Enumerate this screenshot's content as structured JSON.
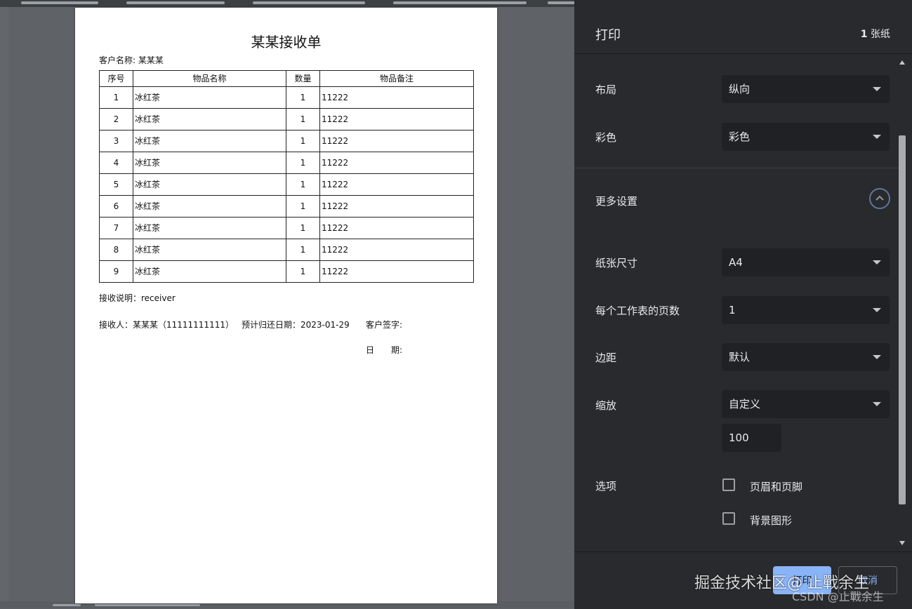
{
  "document": {
    "title": "某某接收单",
    "customer": "客户名称: 某某某",
    "table": {
      "headers": [
        "序号",
        "物品名称",
        "数量",
        "物品备注"
      ],
      "rows": [
        [
          "1",
          "冰红茶",
          "1",
          "11222"
        ],
        [
          "2",
          "冰红茶",
          "1",
          "11222"
        ],
        [
          "3",
          "冰红茶",
          "1",
          "11222"
        ],
        [
          "4",
          "冰红茶",
          "1",
          "11222"
        ],
        [
          "5",
          "冰红茶",
          "1",
          "11222"
        ],
        [
          "6",
          "冰红茶",
          "1",
          "11222"
        ],
        [
          "7",
          "冰红茶",
          "1",
          "11222"
        ],
        [
          "8",
          "冰红茶",
          "1",
          "11222"
        ],
        [
          "9",
          "冰红茶",
          "1",
          "11222"
        ]
      ]
    },
    "receive_note": "接收说明：receiver",
    "receiver": "接收人：某某某（11111111111）",
    "due_date": "预计归还日期：2023-01-29",
    "customer_signature": "客户签字:",
    "date_label": "日　　期:"
  },
  "panel": {
    "title": "打印",
    "sheet_count_num": "1",
    "sheet_count_unit": "张纸",
    "layout": {
      "label": "布局",
      "value": "纵向"
    },
    "color": {
      "label": "彩色",
      "value": "彩色"
    },
    "more_settings": {
      "label": "更多设置",
      "icon": "chevron-up-icon"
    },
    "paper_size": {
      "label": "纸张尺寸",
      "value": "A4"
    },
    "pages_per_sheet": {
      "label": "每个工作表的页数",
      "value": "1"
    },
    "margins": {
      "label": "边距",
      "value": "默认"
    },
    "scale": {
      "label": "缩放",
      "value": "自定义",
      "custom_value": "100"
    },
    "options": {
      "label": "选项",
      "items": [
        {
          "label": "页眉和页脚",
          "checked": false
        },
        {
          "label": "背景图形",
          "checked": false
        }
      ]
    },
    "buttons": {
      "print": "打印",
      "cancel": "取消"
    }
  },
  "watermark": {
    "main": "掘金技术社区@ 止戰余生",
    "sub": "CSDN @止戰余生"
  },
  "colors": {
    "panel_bg": "#292a2d",
    "accent": "#8ab4f8",
    "preview_bg": "#5f6368"
  }
}
